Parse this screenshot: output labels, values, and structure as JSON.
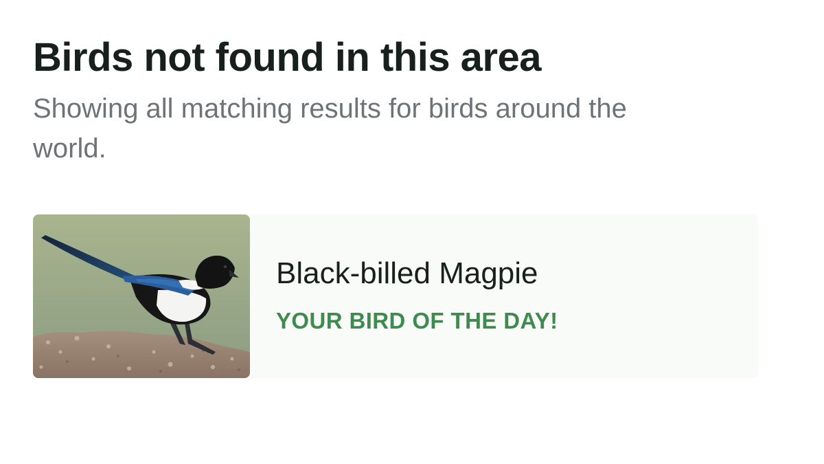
{
  "header": {
    "title": "Birds not found in this area",
    "subtitle": "Showing all matching results for birds around the world."
  },
  "results": [
    {
      "name": "Black-billed Magpie",
      "tag": "YOUR BIRD OF THE DAY!",
      "image_subject": "black-billed-magpie-photo"
    }
  ],
  "colors": {
    "title": "#17201d",
    "subtitle": "#6e7378",
    "accent_green": "#3f8a4e",
    "card_background": "#f8fbf8"
  }
}
